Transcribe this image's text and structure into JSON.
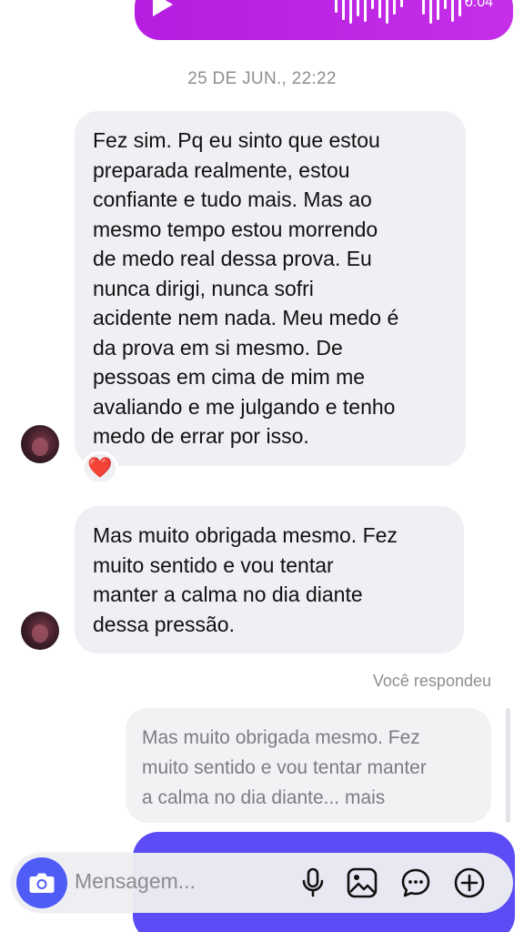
{
  "voice_message": {
    "duration": "0:04"
  },
  "conversation": {
    "timestamp": "25 DE JUN., 22:22",
    "messages": [
      {
        "text": "Fez sim. Pq eu sinto que estou\npreparada realmente, estou\nconfiante e tudo mais. Mas ao\nmesmo tempo estou morrendo\nde medo real dessa prova. Eu\nnunca dirigi, nunca sofri\nacidente nem nada. Meu medo é\nda prova em si mesmo. De\npessoas em cima de mim me\navaliando e me julgando e tenho\nmedo de errar por isso.",
        "reaction": "❤️"
      },
      {
        "text": "Mas muito obrigada mesmo. Fez\nmuito sentido e vou tentar\nmanter a calma no dia diante\ndessa pressão."
      }
    ],
    "reply": {
      "label": "Você respondeu",
      "quote": "Mas muito obrigada mesmo. Fez\nmuito sentido e vou tentar manter\na calma no dia diante... mais"
    }
  },
  "composer": {
    "placeholder": "Mensagem...",
    "icons": [
      "camera-icon",
      "microphone-icon",
      "gallery-icon",
      "sticker-icon",
      "add-icon"
    ]
  },
  "colors": {
    "voice_bubble": "#b51de0",
    "incoming_bubble": "#efeff4",
    "outgoing_bubble": "#5b4cf5",
    "camera_button": "#4f5cf6",
    "reaction_heart": "#e0152b"
  }
}
